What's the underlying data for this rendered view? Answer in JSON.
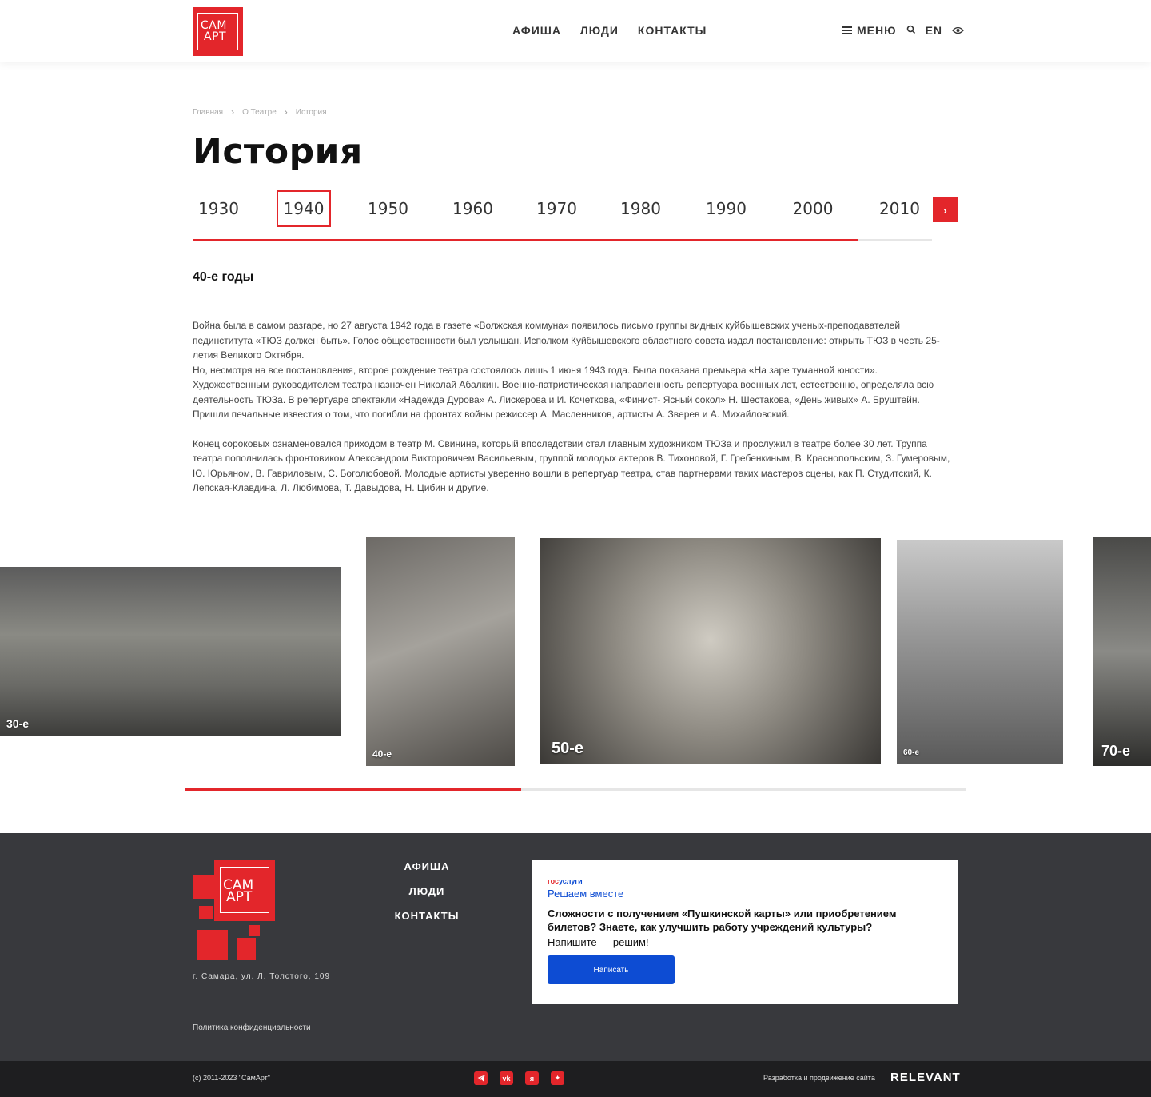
{
  "header": {
    "logo_line1": "САМ",
    "logo_line2": "АРТ",
    "nav": [
      "АФИША",
      "ЛЮДИ",
      "КОНТАКТЫ"
    ],
    "menu_label": "МЕНЮ",
    "lang_label": "EN"
  },
  "breadcrumb": [
    "Главная",
    "О Театре",
    "История"
  ],
  "page_title": "История",
  "decades": {
    "items": [
      "1930",
      "1940",
      "1950",
      "1960",
      "1970",
      "1980",
      "1990",
      "2000",
      "2010"
    ],
    "active": "1940",
    "progress": 0.9
  },
  "content": {
    "section_title": "40-е годы",
    "paragraph1": " Война была в самом разгаре, но 27 августа 1942 года в газете «Волжская коммуна» появилось письмо группы видных куйбышевских ученых-преподавателей пединститута «ТЮЗ должен быть». Голос общественности был услышан. Исполком Куйбышевского областного совета издал постановление: открыть ТЮЗ в честь 25-летия Великого Октября.",
    "paragraph2": "Но, несмотря на все постановления, второе рождение театра состоялось лишь 1 июня 1943 года. Была показана премьера «На заре туманной юности». Художественным руководителем театра назначен Николай Абалкин. Военно-патриотическая направленность репертуара военных лет, естественно, определяла всю деятельность ТЮЗа. В репертуаре спектакли «Надежда Дурова» А. Лискерова и И. Кочеткова, «Финист- Ясный сокол» Н. Шестакова, «День живых» А. Бруштейн. Пришли печальные известия о том, что погибли на фронтах войны режиссер А. Масленников, артисты А. Зверев и А. Михайловский.",
    "paragraph3": "Конец сороковых ознаменовался приходом в театр М. Свинина, который впоследствии стал главным художником ТЮЗа и прослужил в театре более 30 лет. Труппа театра пополнилась фронтовиком Александром Викторовичем Васильевым, группой молодых актеров В. Тихоновой, Г. Гребенкиным, В. Краснопольским, З. Гумеровым, Ю. Юрьяном, В. Гавриловым, С. Боголюбовой. Молодые артисты уверенно вошли в репертуар театра, став партнерами таких мастеров сцены, как П. Студитский, К. Лепская-Клавдина, Л. Любимова, Т. Давыдова, Н. Цибин и другие."
  },
  "gallery": {
    "captions": [
      "30-е",
      "40-е",
      "50-е",
      "60-е",
      "70-е"
    ],
    "progress": 0.43
  },
  "footer": {
    "logo_line1": "САМ",
    "logo_line2": "АРТ",
    "address": "г. Самара, ул. Л. Толстого, 109",
    "privacy": "Политика конфиденциальности",
    "nav": [
      "АФИША",
      "ЛЮДИ",
      "КОНТАКТЫ"
    ],
    "gosuslugi": {
      "logo_part1": "гос",
      "logo_part2": "услуги",
      "slogan": "Решаем вместе",
      "question": "Сложности с получением «Пушкинской карты» или приобретением билетов? Знаете, как улучшить работу учреждений культуры?",
      "cta": "Напишите — решим!",
      "button": "Написать"
    },
    "copyright": "(с) 2011-2023 \"СамАрт\"",
    "socials": [
      "telegram-icon",
      "vk-icon",
      "yandex-icon",
      "zen-icon"
    ],
    "dev_text": "Разработка и продвижение сайта",
    "dev_brand": "RELEVANT"
  },
  "colors": {
    "accent": "#e3262b",
    "footer_bg": "#38393d",
    "gosu_blue": "#0d4cd3"
  }
}
